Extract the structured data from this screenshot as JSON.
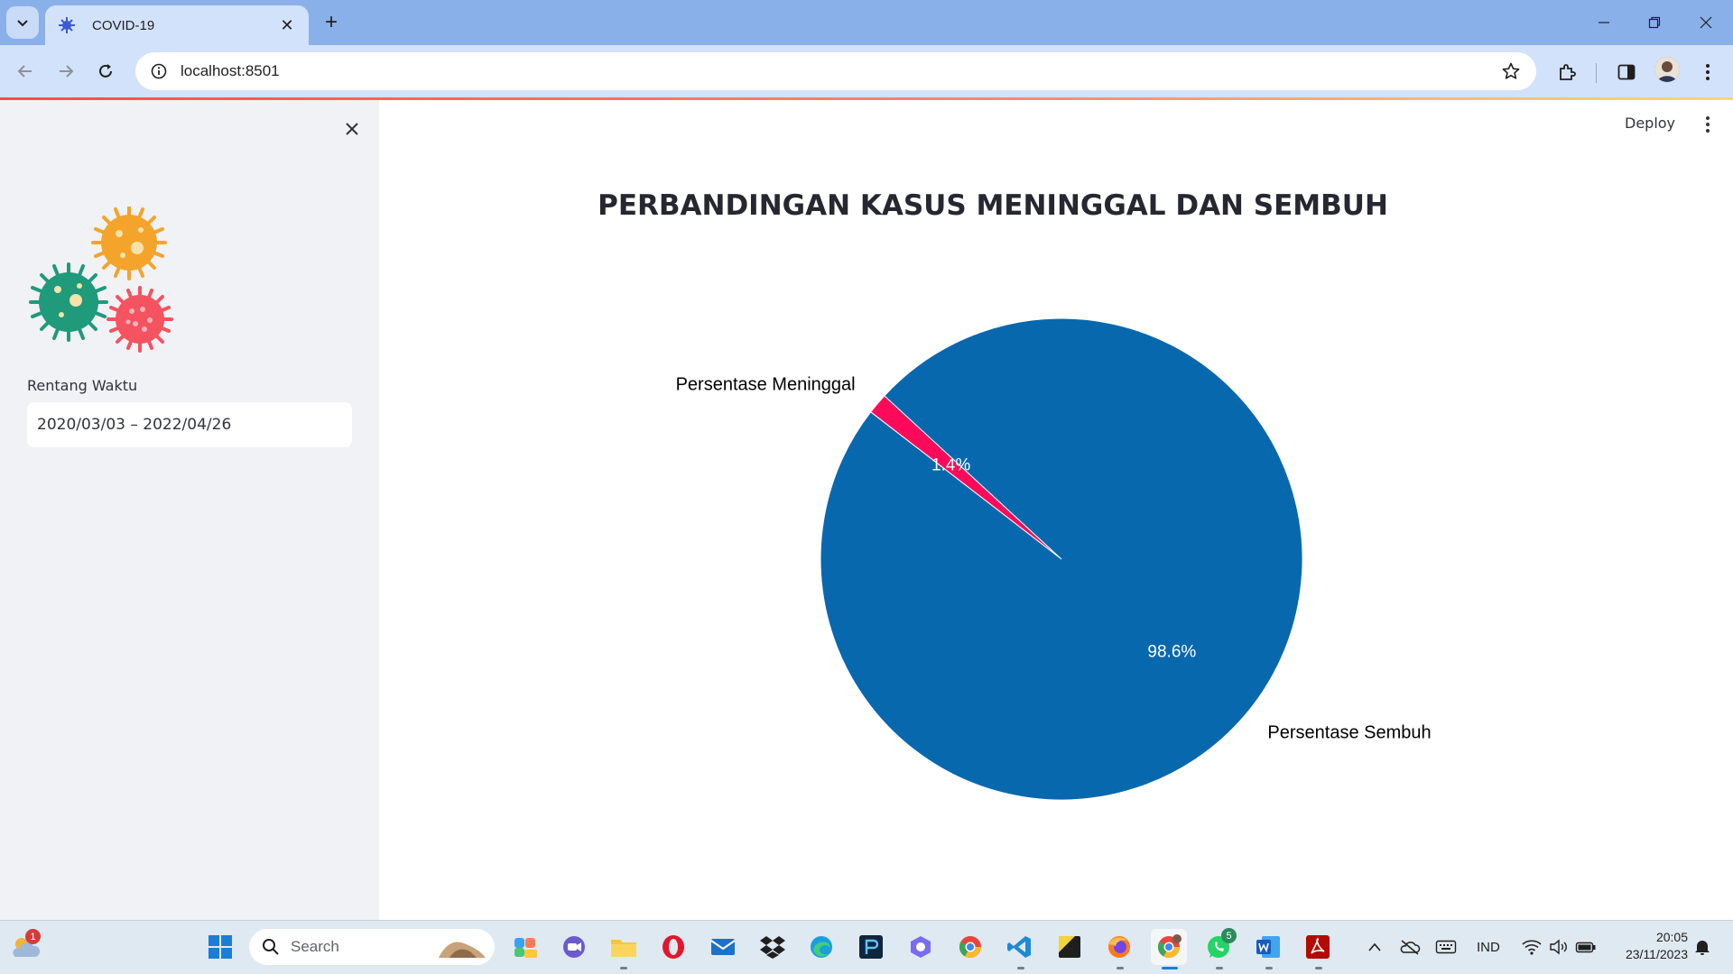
{
  "browser": {
    "tab_title": "COVID-19",
    "url": "localhost:8501"
  },
  "app": {
    "deploy_label": "Deploy",
    "sidebar": {
      "date_label": "Rentang Waktu",
      "date_range_value": "2020/03/03 – 2022/04/26"
    }
  },
  "chart_data": {
    "type": "pie",
    "title": "PERBANDINGAN KASUS MENINGGAL DAN SEMBUH",
    "labels": [
      "Persentase Meninggal",
      "Persentase Sembuh"
    ],
    "values": [
      1.4,
      98.6
    ],
    "value_labels": [
      "1.4%",
      "98.6%"
    ],
    "colors": [
      "#ff0a5a",
      "#0868ae"
    ],
    "legend": "none"
  },
  "taskbar": {
    "search_label": "Search",
    "weather_badge": "1",
    "whatsapp_badge": "5",
    "language": "IND",
    "time": "20:05",
    "date": "23/11/2023"
  }
}
